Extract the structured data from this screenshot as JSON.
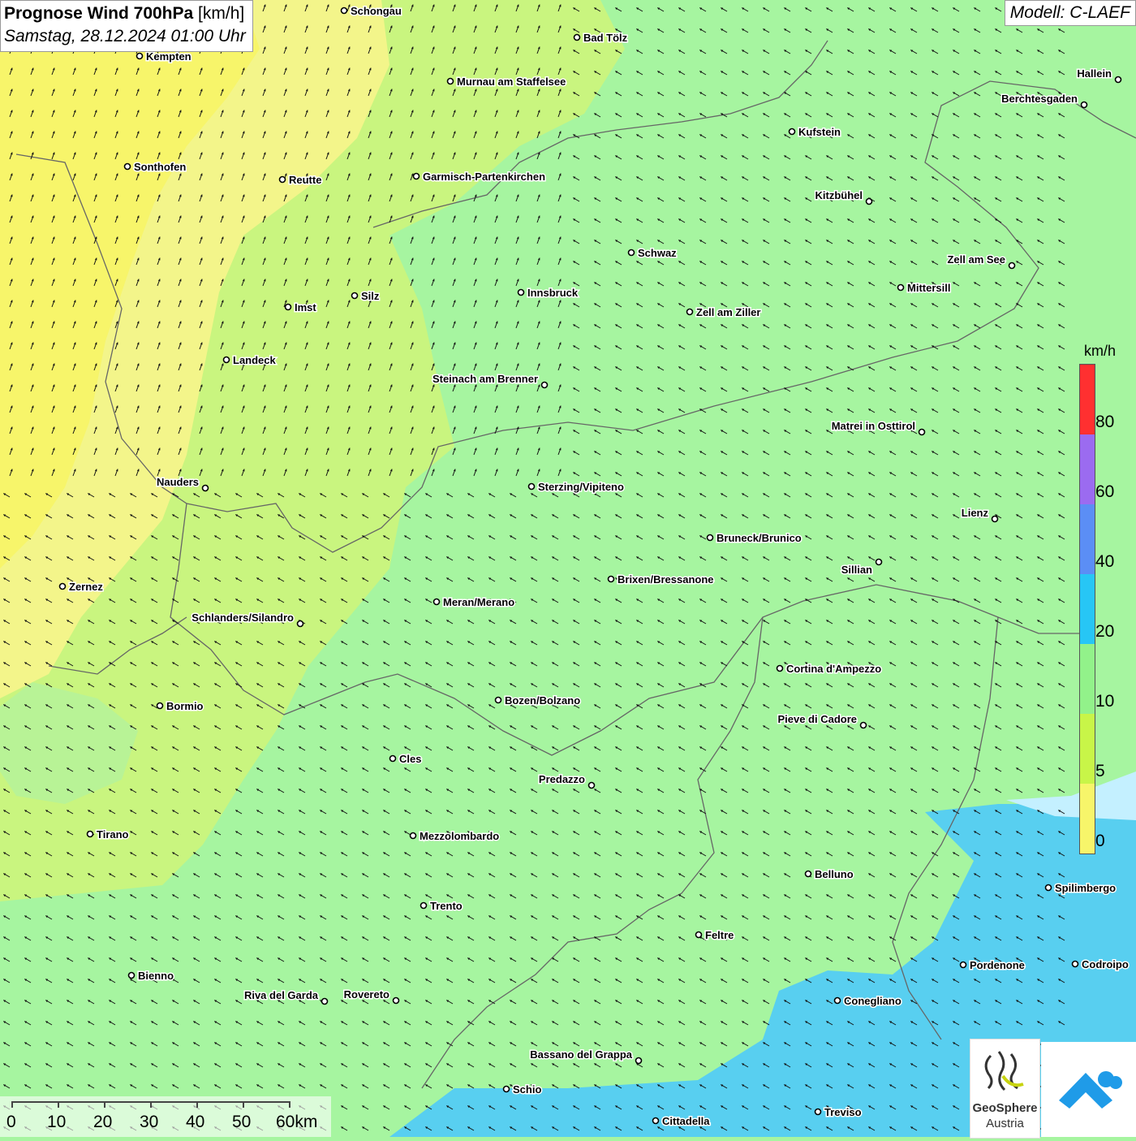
{
  "title": {
    "main": "Prognose Wind 700hPa",
    "unit": "[km/h]",
    "datetime": "Samstag, 28.12.2024 01:00 Uhr"
  },
  "model": "Modell: C-LAEF",
  "legend": {
    "unit": "km/h",
    "labels": [
      "80",
      "60",
      "40",
      "20",
      "10",
      "5",
      "0"
    ],
    "colors": [
      "#ff3030",
      "#9b6bf0",
      "#5b8ef5",
      "#27c6f5",
      "#92f28a",
      "#c8f548",
      "#f7f56a"
    ]
  },
  "scalebar": {
    "labels": [
      "0",
      "10",
      "20",
      "30",
      "40",
      "50",
      "60km"
    ]
  },
  "logo": {
    "line1": "GeoSphere",
    "line2": "Austria"
  },
  "cities": [
    {
      "name": "Schongau"
    },
    {
      "name": "Bad Tölz"
    },
    {
      "name": "Kempten"
    },
    {
      "name": "Murnau am Staffelsee"
    },
    {
      "name": "Hallein"
    },
    {
      "name": "Berchtesgaden"
    },
    {
      "name": "Kufstein"
    },
    {
      "name": "Sonthofen"
    },
    {
      "name": "Reutte"
    },
    {
      "name": "Garmisch-Partenkirchen"
    },
    {
      "name": "Kitzbühel"
    },
    {
      "name": "Schwaz"
    },
    {
      "name": "Zell am See"
    },
    {
      "name": "Innsbruck"
    },
    {
      "name": "Mittersill"
    },
    {
      "name": "Silz"
    },
    {
      "name": "Imst"
    },
    {
      "name": "Zell am Ziller"
    },
    {
      "name": "Landeck"
    },
    {
      "name": "Steinach am Brenner"
    },
    {
      "name": "Matrei in Osttirol"
    },
    {
      "name": "Nauders"
    },
    {
      "name": "Sterzing/Vipiteno"
    },
    {
      "name": "Lienz"
    },
    {
      "name": "Bruneck/Brunico"
    },
    {
      "name": "Sillian"
    },
    {
      "name": "Brixen/Bressanone"
    },
    {
      "name": "Zernez"
    },
    {
      "name": "Meran/Merano"
    },
    {
      "name": "Schlanders/Silandro"
    },
    {
      "name": "Cortina d'Ampezzo"
    },
    {
      "name": "Bozen/Bolzano"
    },
    {
      "name": "Bormio"
    },
    {
      "name": "Pieve di Cadore"
    },
    {
      "name": "Cles"
    },
    {
      "name": "Predazzo"
    },
    {
      "name": "Tirano"
    },
    {
      "name": "Mezzolombardo"
    },
    {
      "name": "Belluno"
    },
    {
      "name": "Spilimbergo"
    },
    {
      "name": "Trento"
    },
    {
      "name": "Feltre"
    },
    {
      "name": "Pordenone"
    },
    {
      "name": "Codroipo"
    },
    {
      "name": "Bienno"
    },
    {
      "name": "Riva del Garda"
    },
    {
      "name": "Rovereto"
    },
    {
      "name": "Conegliano"
    },
    {
      "name": "Bassano del Grappa"
    },
    {
      "name": "Schio"
    },
    {
      "name": "Treviso"
    },
    {
      "name": "Cittadella"
    }
  ]
}
